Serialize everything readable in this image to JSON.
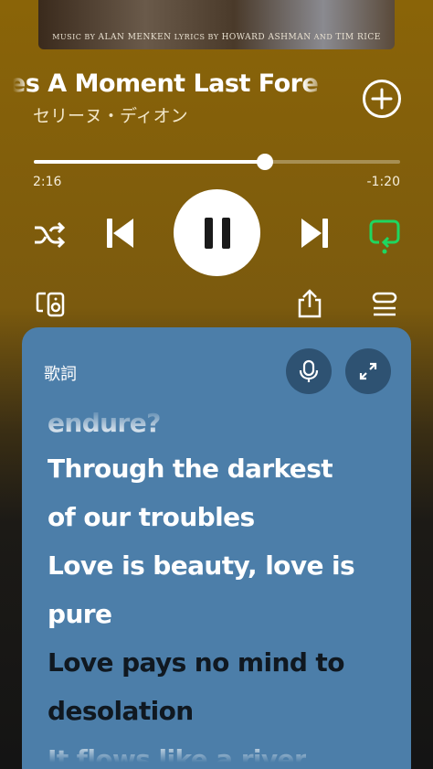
{
  "album": {
    "credits_music_prefix": "MUSIC BY",
    "credits_music_name": "ALAN MENKEN",
    "credits_lyrics_prefix": "LYRICS BY",
    "credits_lyrics_name": "HOWARD ASHMAN",
    "credits_and": "AND",
    "credits_lyrics_name2": "TIM RICE"
  },
  "track": {
    "title": "es A Moment Last Fore",
    "artist": "セリーヌ・ディオン",
    "add_icon": "plus-circle-icon"
  },
  "progress": {
    "elapsed": "2:16",
    "remaining": "-1:20",
    "fraction": 0.63
  },
  "controls": {
    "shuffle_icon": "shuffle-icon",
    "prev_icon": "skip-previous-icon",
    "pause_icon": "pause-icon",
    "next_icon": "skip-next-icon",
    "repeat_icon": "repeat-icon",
    "device_icon": "connect-device-icon",
    "share_icon": "share-icon",
    "queue_icon": "queue-icon",
    "accent_color": "#1ed760"
  },
  "lyrics": {
    "heading": "歌詞",
    "mic_icon": "microphone-icon",
    "expand_icon": "expand-icon",
    "card_color": "#4c7ea9",
    "lines": [
      {
        "text": "endure?",
        "state": "faded"
      },
      {
        "text": "Through the darkest",
        "state": "active"
      },
      {
        "text": "of our troubles",
        "state": "active"
      },
      {
        "text": "Love is beauty, love is",
        "state": "active"
      },
      {
        "text": "pure",
        "state": "active"
      },
      {
        "text": "Love pays no mind to",
        "state": "upcoming"
      },
      {
        "text": "desolation",
        "state": "upcoming"
      },
      {
        "text": "It flows like a river",
        "state": "bottom"
      }
    ]
  }
}
